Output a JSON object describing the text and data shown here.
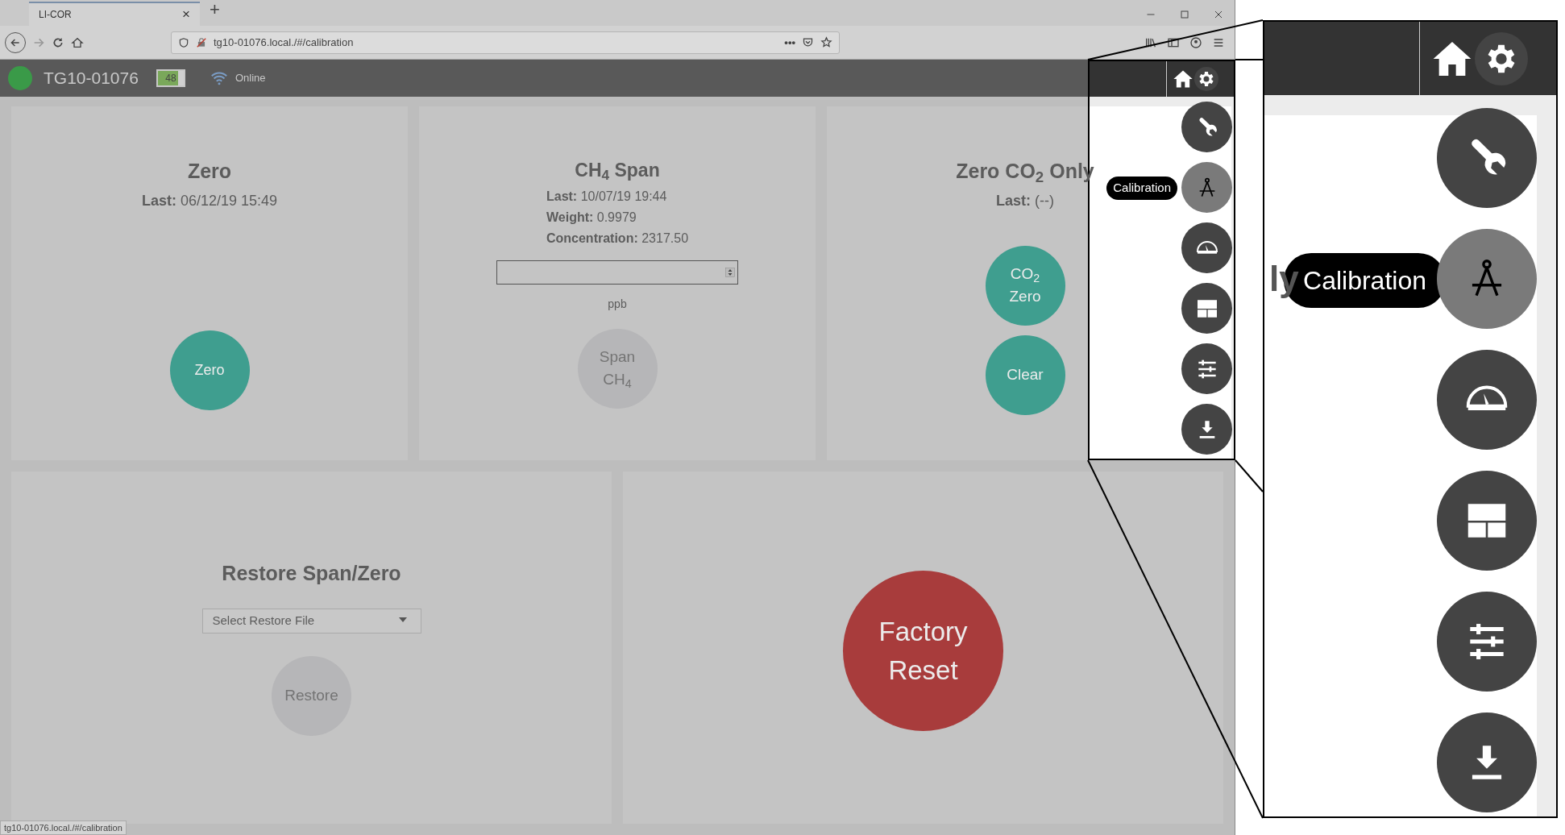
{
  "browser": {
    "tab_title": "LI-COR",
    "tab_close": "×",
    "new_tab": "+",
    "url": "tg10-01076.local./#/calibration",
    "page_actions": "•••",
    "status_url": "tg10-01076.local./#/calibration"
  },
  "app_header": {
    "device": "TG10-01076",
    "battery": "48",
    "connection": "Online"
  },
  "cards": [
    {
      "kind": "zero",
      "title": "Zero",
      "lines": [
        "**Last:** 06/12/19 15:49"
      ],
      "buttons": [
        {
          "label_lines": [
            "Zero"
          ],
          "disabled": false
        }
      ]
    },
    {
      "kind": "span",
      "title": "CH$_{4}$ Span",
      "lines": [
        "**Last:** 10/07/19 19:44",
        "**Weight:** 0.9979",
        "**Concentration:** 2317.50"
      ],
      "unit": "ppb",
      "buttons": [
        {
          "label_lines": [
            "Span",
            "CH$_{4}$"
          ],
          "disabled": true
        }
      ]
    },
    {
      "kind": "co2",
      "title": "Zero CO$_{2}$ Only",
      "lines": [
        "**Last:** (--)"
      ],
      "buttons": [
        {
          "label_lines": [
            "CO$_{2}$",
            "Zero"
          ],
          "disabled": false
        },
        {
          "label_lines": [
            "Clear"
          ],
          "disabled": false
        }
      ]
    },
    {
      "kind": "restore",
      "title": "Restore Span/Zero",
      "select": "Select Restore File",
      "buttons": [
        {
          "label_lines": [
            "Restore"
          ],
          "disabled": true
        }
      ]
    },
    {
      "kind": "reset",
      "buttons": [
        {
          "label_lines": [
            "Factory",
            "Reset"
          ],
          "disabled": false
        }
      ]
    }
  ],
  "side_menu": {
    "tooltip": "Calibration",
    "items": [
      {
        "selected": false
      },
      {
        "selected": true
      },
      {
        "selected": false
      },
      {
        "selected": false
      },
      {
        "selected": false
      },
      {
        "selected": false
      }
    ]
  },
  "callout": {
    "title_fragment": "ly",
    "tooltip": "Calibration",
    "items": [
      {
        "selected": false
      },
      {
        "selected": true
      },
      {
        "selected": false
      },
      {
        "selected": false
      },
      {
        "selected": false
      },
      {
        "selected": false
      }
    ]
  }
}
